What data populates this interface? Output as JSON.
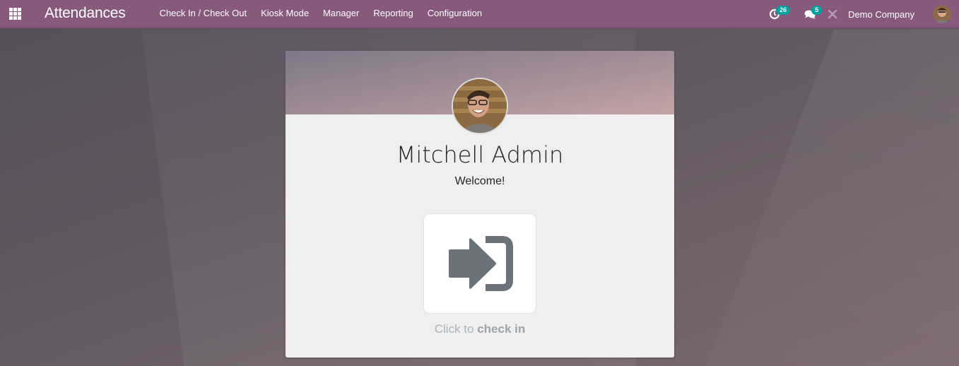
{
  "navbar": {
    "apps_icon": "grid-icon",
    "brand": "Attendances",
    "menu": [
      {
        "label": "Check In / Check Out"
      },
      {
        "label": "Kiosk Mode"
      },
      {
        "label": "Manager"
      },
      {
        "label": "Reporting"
      },
      {
        "label": "Configuration"
      }
    ],
    "systray": {
      "activities": {
        "icon": "clock-icon",
        "count": "26"
      },
      "messages": {
        "icon": "chat-icon",
        "count": "5"
      },
      "debug": {
        "icon": "tools-icon"
      },
      "company": "Demo Company",
      "user_avatar": "user-avatar"
    }
  },
  "card": {
    "employee_name": "Mitchell Admin",
    "greeting": "Welcome!",
    "action_icon": "sign-in-icon",
    "click_prefix": "Click to ",
    "click_action": "check in"
  },
  "colors": {
    "navbar": "#875a7b",
    "badge": "#00a09d",
    "icon_gray": "#6c757d"
  }
}
